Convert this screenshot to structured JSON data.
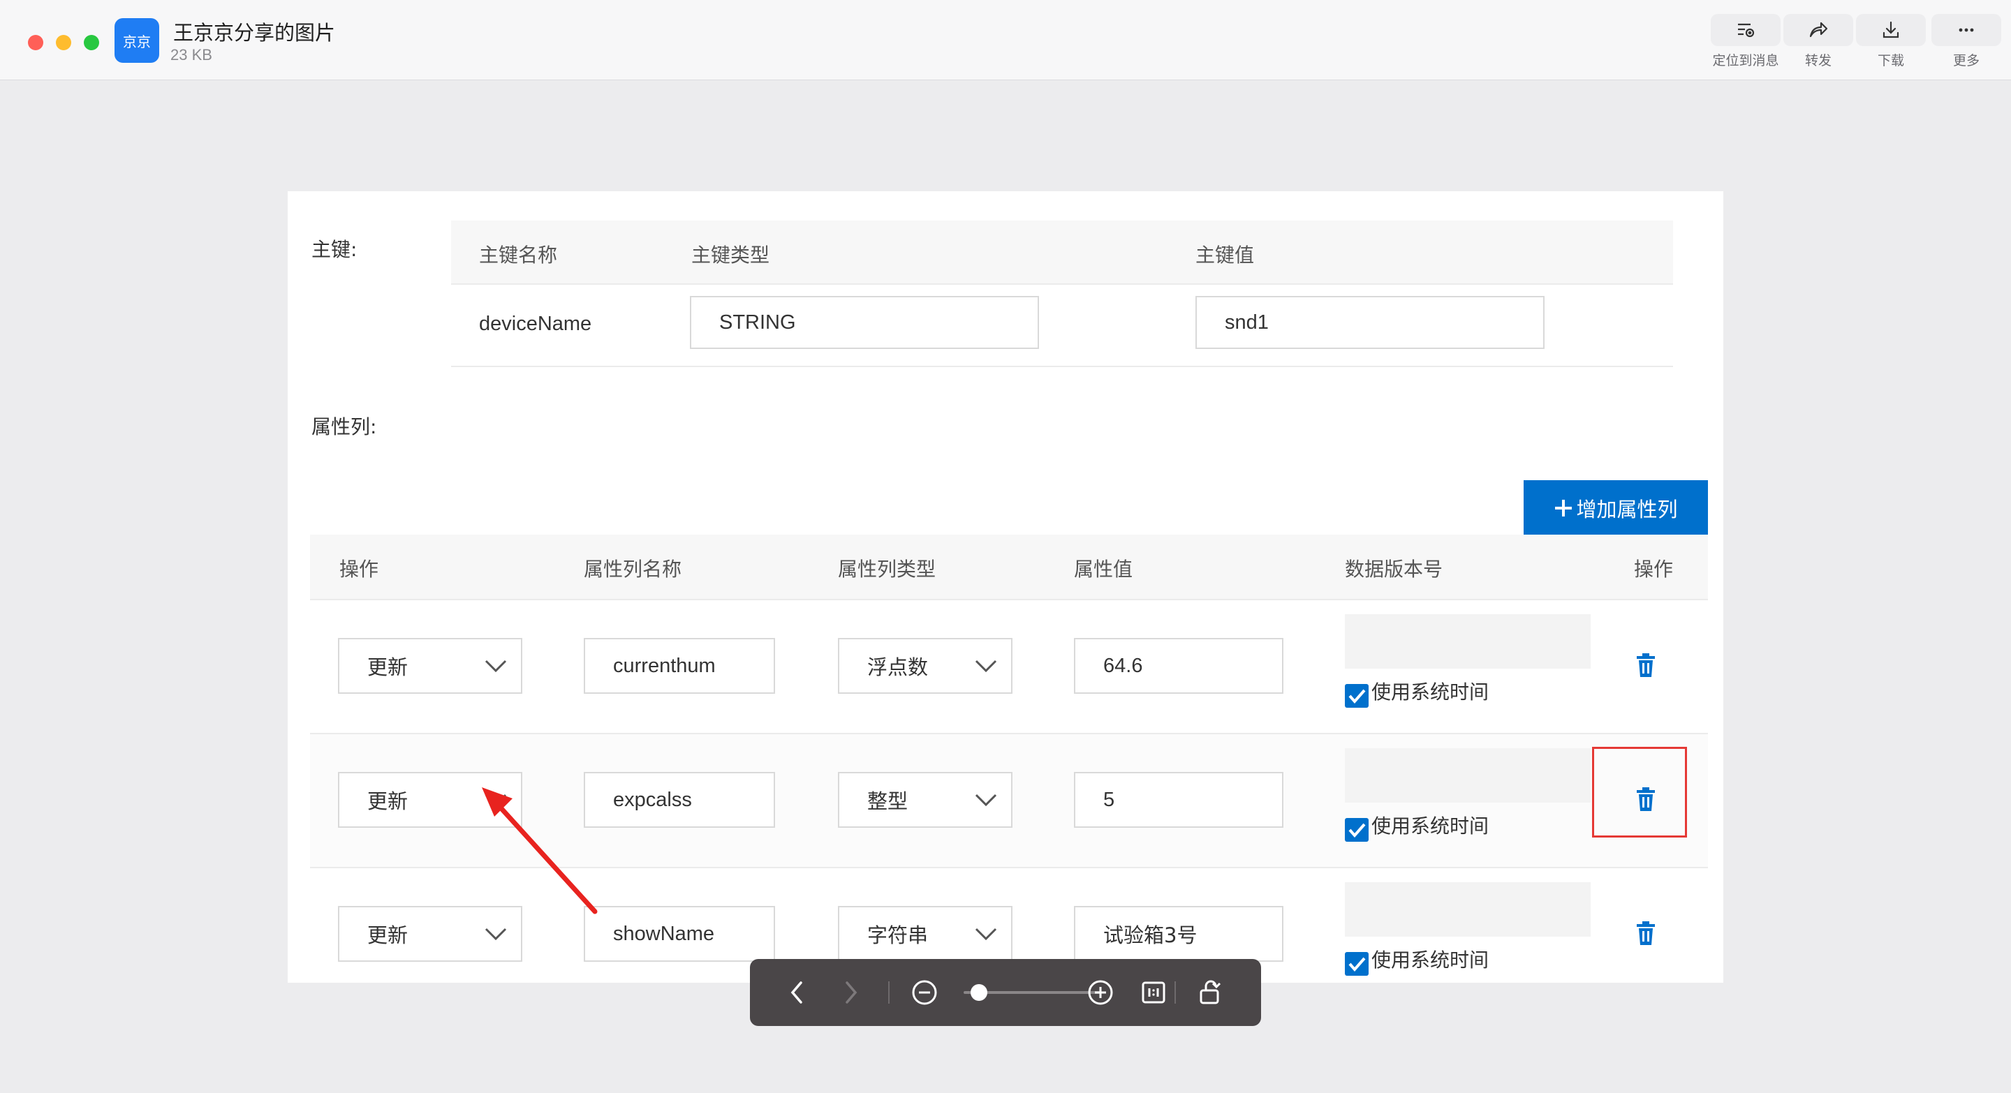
{
  "window": {
    "app_badge": "京京",
    "file_title": "王京京分享的图片",
    "file_size": "23 KB",
    "toolbar": [
      {
        "label": "定位到消息",
        "icon": "locate-message-icon"
      },
      {
        "label": "转发",
        "icon": "forward-icon"
      },
      {
        "label": "下载",
        "icon": "download-icon"
      },
      {
        "label": "更多",
        "icon": "more-icon"
      }
    ]
  },
  "form": {
    "primary_key_label": "主键:",
    "pk_headers": [
      "主键名称",
      "主键类型",
      "主键值"
    ],
    "pk_row": {
      "name": "deviceName",
      "type": "STRING",
      "value": "snd1"
    },
    "attr_label": "属性列:",
    "add_button": "增加属性列",
    "attr_headers": [
      "操作",
      "属性列名称",
      "属性列类型",
      "属性值",
      "数据版本号",
      "操作"
    ],
    "rows": [
      {
        "operation": "更新",
        "name": "currenthum",
        "type": "浮点数",
        "value": "64.6",
        "use_system_time": "使用系统时间",
        "checked": true
      },
      {
        "operation": "更新",
        "name": "expcalss",
        "type": "整型",
        "value": "5",
        "use_system_time": "使用系统时间",
        "checked": true
      },
      {
        "operation": "更新",
        "name": "showName",
        "type": "字符串",
        "value": "试验箱3号",
        "use_system_time": "使用系统时间",
        "checked": true
      }
    ]
  },
  "annotation": {
    "highlight_color": "#e53935",
    "arrow_color": "#e8231f"
  },
  "viewer": {
    "controls": [
      "previous-icon",
      "next-icon",
      "zoom-out-icon",
      "zoom-slider",
      "zoom-in-icon",
      "actual-size-icon",
      "rotate-icon"
    ],
    "zoom_level_fraction": 0.1
  },
  "colors": {
    "accent": "#0070cc",
    "background": "#ececee"
  }
}
